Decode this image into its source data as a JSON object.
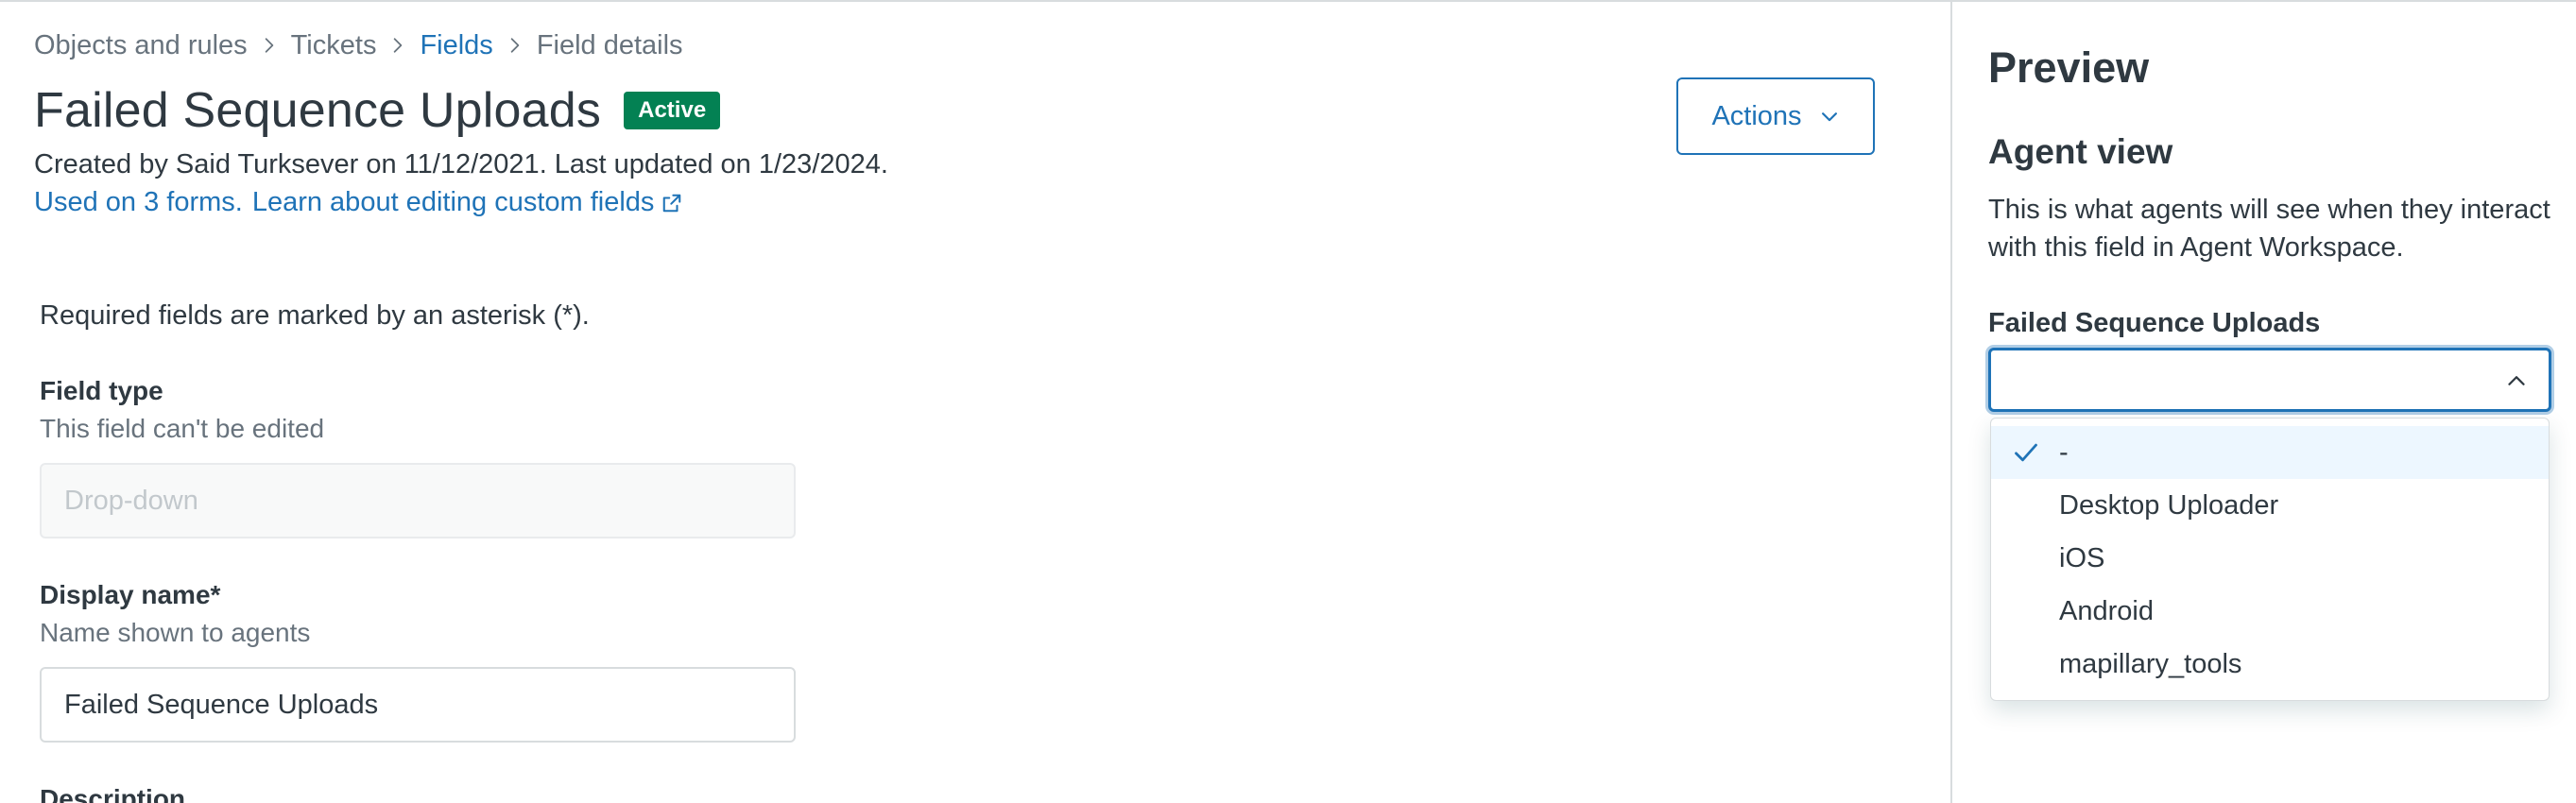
{
  "breadcrumb": [
    {
      "label": "Objects and rules",
      "link": false
    },
    {
      "label": "Tickets",
      "link": false
    },
    {
      "label": "Fields",
      "link": true
    },
    {
      "label": "Field details",
      "link": false
    }
  ],
  "page": {
    "title": "Failed Sequence Uploads",
    "status_badge": "Active",
    "meta": "Created by Said Turksever on 11/12/2021. Last updated on 1/23/2024.",
    "used_on_link": "Used on 3 forms.",
    "learn_link": "Learn about editing custom fields"
  },
  "actions": {
    "label": "Actions"
  },
  "form": {
    "required_note": "Required fields are marked by an asterisk (*).",
    "field_type": {
      "label": "Field type",
      "hint": "This field can't be edited",
      "value": "Drop-down"
    },
    "display_name": {
      "label": "Display name*",
      "hint": "Name shown to agents",
      "value": "Failed Sequence Uploads"
    },
    "description": {
      "label": "Description"
    }
  },
  "preview": {
    "title": "Preview",
    "agent_view_heading": "Agent view",
    "agent_view_desc": "This is what agents will see when they interact with this field in Agent Workspace.",
    "field_label": "Failed Sequence Uploads",
    "options": [
      {
        "label": "-",
        "selected": true
      },
      {
        "label": "Desktop Uploader",
        "selected": false
      },
      {
        "label": "iOS",
        "selected": false
      },
      {
        "label": "Android",
        "selected": false
      },
      {
        "label": "mapillary_tools",
        "selected": false
      }
    ]
  },
  "colors": {
    "link": "#1f73b7",
    "active_badge": "#038153",
    "text": "#2f3941",
    "muted": "#68737d",
    "selected_option_bg": "#edf7ff"
  },
  "icons": {
    "breadcrumb_separator": "chevron-right-icon",
    "external_link": "external-link-icon",
    "actions_chevron": "chevron-down-icon",
    "select_chevron": "chevron-up-icon",
    "selected_check": "check-icon"
  }
}
